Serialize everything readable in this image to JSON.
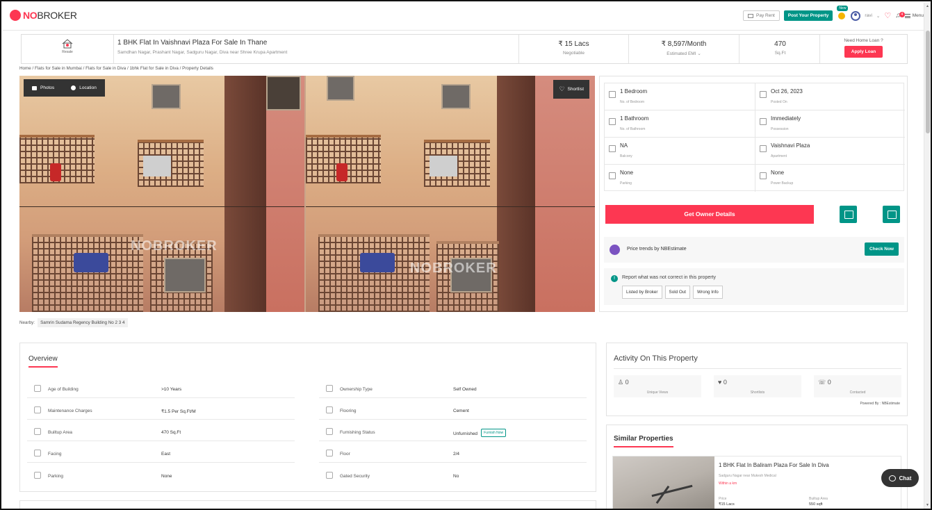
{
  "topbar": {
    "logo_no": "NO",
    "logo_broker": "BROKER",
    "pay_rent": "Pay Rent",
    "post_property": "Post Your Property",
    "new_badge": "New",
    "user_name": "ravi",
    "menu_label": "Menu",
    "notification_count": "4"
  },
  "property": {
    "badge_label": "Resale",
    "title": "1 BHK Flat In Vaishnavi Plaza For Sale In Thane",
    "address": "Samdhan Nagar, Prashant Nagar, Sadguru Nagar, Diva near Shree Krupa Apartment",
    "price": "₹ 15 Lacs",
    "price_sub": "Negotiable",
    "emi": "₹ 8,597/Month",
    "emi_sub": "Estimated EMI",
    "area": "470",
    "area_sub": "Sq.Ft",
    "loan_q": "Need Home Loan ?",
    "loan_btn": "Apply Loan"
  },
  "breadcrumb": "Home / Flats for Sale in Mumbai / Flats for Sale in Diva / 1bhk Flat for Sale in Diva / Property Details",
  "gallery": {
    "photos_btn": "Photos",
    "location_btn": "Location",
    "shortlist_btn": "Shortlist",
    "watermark": "NOBROKER"
  },
  "nearby": {
    "label": "Nearby:",
    "tag": "Samrin Sudama Regency Building No 2 3 4"
  },
  "details": [
    {
      "value": "1 Bedroom",
      "label": "No. of Bedroom"
    },
    {
      "value": "Oct 26, 2023",
      "label": "Posted On"
    },
    {
      "value": "1 Bathroom",
      "label": "No. of Bathroom"
    },
    {
      "value": "Immediately",
      "label": "Possession"
    },
    {
      "value": "NA",
      "label": "Balcony"
    },
    {
      "value": "Vaishnavi Plaza",
      "label": "Apartment"
    },
    {
      "value": "None",
      "label": "Parking"
    },
    {
      "value": "None",
      "label": "Power Backup"
    }
  ],
  "actions": {
    "owner_btn": "Get Owner Details",
    "trend_text": "Price trends by NBEstimate",
    "check_now": "Check Now",
    "report_text": "Report what was not correct in this property",
    "report_btns": [
      "Listed by Broker",
      "Sold Out",
      "Wrong Info"
    ]
  },
  "overview": {
    "title": "Overview",
    "rows": [
      {
        "label": "Age of Building",
        "value": ">10 Years"
      },
      {
        "label": "Ownership Type",
        "value": "Self Owned"
      },
      {
        "label": "Maintenance Charges",
        "value": "₹1.5 Per Sq.Ft/M"
      },
      {
        "label": "Flooring",
        "value": "Cement"
      },
      {
        "label": "Builtup Area",
        "value": "470 Sq.Ft"
      },
      {
        "label": "Furnishing Status",
        "value": "Unfurnished"
      },
      {
        "label": "Facing",
        "value": "East"
      },
      {
        "label": "Floor",
        "value": "2/4"
      },
      {
        "label": "Parking",
        "value": "None"
      },
      {
        "label": "Gated Security",
        "value": "No"
      }
    ],
    "furnish_now": "Furnish Now"
  },
  "activity": {
    "title": "Activity On This Property",
    "stats": [
      {
        "count": "0",
        "label": "Unique Views"
      },
      {
        "count": "0",
        "label": "Shortlists"
      },
      {
        "count": "0",
        "label": "Contacted"
      }
    ],
    "powered": "Powered By : NBEstimate"
  },
  "similar": {
    "title": "Similar Properties",
    "name": "1 BHK Flat In Baliram Plaza For Sale In Diva",
    "location": "Sadguru Nagar near Mukesh Medical",
    "distance": "Within a km",
    "price_label": "Price",
    "price": "₹15 Lacs",
    "area_label": "Builtup Area",
    "area": "550 sqft"
  },
  "chat_label": "Chat"
}
